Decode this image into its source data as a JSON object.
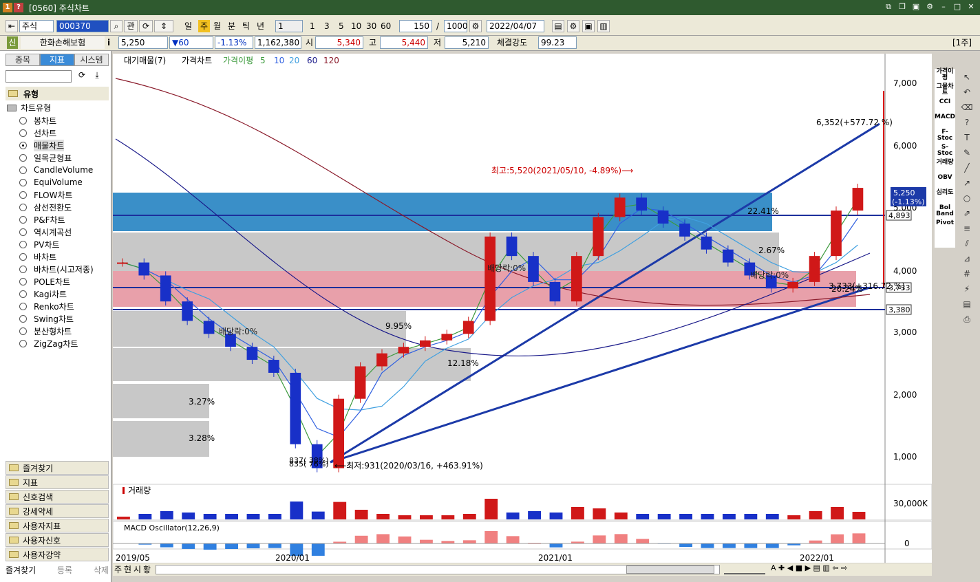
{
  "window": {
    "title": "[0560] 주식차트",
    "icons": [
      "1",
      "?"
    ]
  },
  "toolbar": {
    "market": "주식",
    "code": "000370",
    "btn_gwan": "관",
    "periods": [
      "일",
      "주",
      "월",
      "분",
      "틱",
      "년"
    ],
    "active_period": "주",
    "interval": "1",
    "quick": [
      "1",
      "3",
      "5",
      "10",
      "30",
      "60"
    ],
    "count": "150",
    "slash": "/",
    "max": "1000",
    "date": "2022/04/07"
  },
  "quote": {
    "badge": "신",
    "name": "한화손해보험",
    "info_icon": "i",
    "price": "5,250",
    "change": "▼60",
    "rate": "-1.13%",
    "volume": "1,162,380",
    "open_label": "시",
    "open": "5,340",
    "high_label": "고",
    "high": "5,440",
    "low_label": "저",
    "low": "5,210",
    "strength_label": "체결강도",
    "strength": "99.23",
    "unit": "[1주]"
  },
  "sidebar": {
    "tabs": [
      "종목",
      "지표",
      "시스템"
    ],
    "section": "유형",
    "subsection": "차트유형",
    "chart_types": [
      "봉차트",
      "선차트",
      "매물차트",
      "일목균형표",
      "CandleVolume",
      "EquiVolume",
      "FLOW차트",
      "삼선전환도",
      "P&F차트",
      "역시계곡선",
      "PV차트",
      "바차트",
      "바차트(시고저종)",
      "POLE차트",
      "Kagi차트",
      "Renko차트",
      "Swing차트",
      "분산형차트",
      "ZigZag차트"
    ],
    "selected": "매물차트",
    "folders": [
      "즐겨찾기",
      "지표",
      "신호검색",
      "강세약세",
      "사용자지표",
      "사용자신호",
      "사용자강약"
    ],
    "bottom": [
      "즐겨찾기",
      "등록",
      "삭제"
    ]
  },
  "chart": {
    "legend": {
      "pv": "대기매물(7)",
      "price": "가격차트",
      "ma_label": "가격이평",
      "ma": [
        "5",
        "10",
        "20",
        "60",
        "120"
      ]
    },
    "ma_colors": [
      "#3c9a3c",
      "#3060e0",
      "#40a0e0",
      "#1a1a8a",
      "#8a1a2a"
    ],
    "y_ticks": [
      "7,000",
      "6,000",
      "5,000",
      "4,000",
      "3,000",
      "2,000",
      "1,000"
    ],
    "x_ticks": [
      "2019/05",
      "2020/01",
      "2021/01",
      "2022/01"
    ],
    "price_flag": "5,250",
    "price_flag_rate": "(-1.13%)",
    "level_labels": [
      "4,893",
      "3,733",
      "3,380"
    ],
    "annotations": {
      "high": "최고:5,520(2021/05/10, -4.89%)⟶",
      "low": "⟵최저:931(2020/03/16, +463.91%)",
      "target": "6,352(+577.72 %)",
      "trend": "3,733(+316.72 %)",
      "div1": "배당락:0%",
      "div2": "배당락:0%",
      "div3": "배당락:0%",
      "pv_pcts": [
        "22.41%",
        "2.67%",
        "20.24%",
        "9.95%",
        "12.18%",
        "3.27%",
        "3.28%"
      ],
      "low_pct": "837( 38%)",
      "low_pct2": "835( 76%)"
    },
    "volume_label": "거래량",
    "volume_tick": "30,000K",
    "macd_label": "MACD Oscillator(12,26,9)",
    "macd_tick": "0"
  },
  "right_indicators": [
    "가격이평",
    "그물차트",
    "CCI",
    "MACD",
    "F-Stoc",
    "S-Stoc",
    "거래량",
    "OBV",
    "심리도",
    "Bol Band",
    "Pivot"
  ],
  "bottom_tabs": [
    "주",
    "현",
    "시",
    "황"
  ],
  "chart_data": {
    "type": "candlestick",
    "x": [
      "2019/05",
      "2020/01",
      "2021/01",
      "2022/01"
    ],
    "ylim": [
      800,
      7300
    ],
    "values": [
      4100,
      3900,
      3500,
      3200,
      3000,
      2800,
      2600,
      2400,
      1300,
      931,
      2000,
      2500,
      2700,
      2800,
      2900,
      3000,
      3200,
      4500,
      4200,
      3800,
      3500,
      4200,
      4800,
      5100,
      4900,
      4700,
      4500,
      4300,
      4100,
      3900,
      3700,
      3800,
      4200,
      4900,
      5250
    ]
  }
}
